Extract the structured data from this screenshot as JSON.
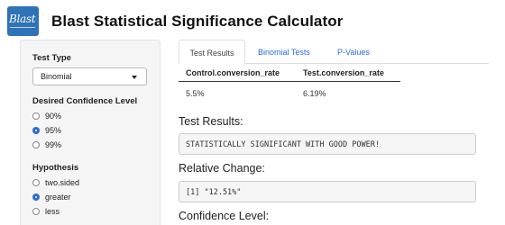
{
  "header": {
    "logo_text": "Blast",
    "title": "Blast Statistical Significance Calculator"
  },
  "sidebar": {
    "test_type": {
      "label": "Test Type",
      "selected": "Binomial"
    },
    "confidence": {
      "label": "Desired Confidence Level",
      "options": [
        {
          "label": "90%",
          "checked": false
        },
        {
          "label": "95%",
          "checked": true
        },
        {
          "label": "99%",
          "checked": false
        }
      ]
    },
    "hypothesis": {
      "label": "Hypothesis",
      "options": [
        {
          "label": "two.sided",
          "checked": false
        },
        {
          "label": "greater",
          "checked": true
        },
        {
          "label": "less",
          "checked": false
        }
      ]
    }
  },
  "main": {
    "tabs": [
      {
        "label": "Test Results",
        "active": true
      },
      {
        "label": "Binomial Tests",
        "active": false
      },
      {
        "label": "P-Values",
        "active": false
      }
    ],
    "table": {
      "headers": [
        "Control.conversion_rate",
        "Test.conversion_rate"
      ],
      "rows": [
        [
          "5.5%",
          "6.19%"
        ]
      ]
    },
    "test_results": {
      "title": "Test Results:",
      "output": "STATISTICALLY SIGNIFICANT WITH GOOD POWER!"
    },
    "relative_change": {
      "title": "Relative Change:",
      "output": "[1] \"12.51%\""
    },
    "confidence_level": {
      "title": "Confidence Level:"
    }
  },
  "colors": {
    "accent": "#2a6cd9",
    "logo": "#2e72b8",
    "panel": "#f5f5f5"
  }
}
